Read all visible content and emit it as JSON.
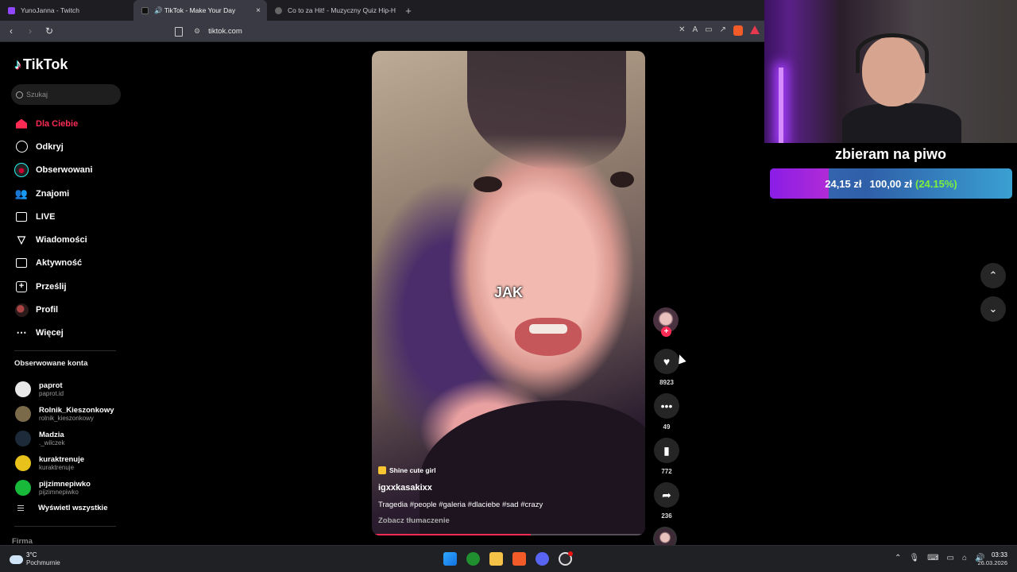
{
  "browser": {
    "tabs": [
      {
        "label": "YunoJanna - Twitch",
        "favicon_color": "#9146ff",
        "active": false
      },
      {
        "label": "🔊 TikTok - Make Your Day",
        "favicon_color": "#111111",
        "active": true
      },
      {
        "label": "Co to za Hit! - Muzyczny Quiz Hip-H",
        "favicon_color": "#666666",
        "active": false
      }
    ],
    "new_tab": "+",
    "close_glyph": "×",
    "url": "tiktok.com"
  },
  "tiktok": {
    "logo": "TikTok",
    "search_placeholder": "Szukaj",
    "menu": [
      {
        "label": "Dla Ciebie",
        "icon": "home-icon",
        "active": true
      },
      {
        "label": "Odkryj",
        "icon": "compass-icon",
        "active": false
      },
      {
        "label": "Obserwowani",
        "icon": "following-avatar-icon",
        "active": false
      },
      {
        "label": "Znajomi",
        "icon": "friends-icon",
        "active": false
      },
      {
        "label": "LIVE",
        "icon": "live-tv-icon",
        "active": false
      },
      {
        "label": "Wiadomości",
        "icon": "messages-icon",
        "active": false
      },
      {
        "label": "Aktywność",
        "icon": "activity-icon",
        "active": false
      },
      {
        "label": "Prześlij",
        "icon": "upload-icon",
        "active": false
      },
      {
        "label": "Profil",
        "icon": "profile-avatar-icon",
        "active": false
      },
      {
        "label": "Więcej",
        "icon": "more-icon",
        "active": false
      }
    ],
    "followed_title": "Obserwowane konta",
    "followed": [
      {
        "name": "paprot",
        "handle": "paprot.id",
        "color": "#e8e8e8"
      },
      {
        "name": "Rolnik_Kieszonkowy",
        "handle": "rolnik_kieszonkowy",
        "color": "#7a6a4a"
      },
      {
        "name": "Madzia",
        "handle": "._wilczek",
        "color": "#1c2a3a"
      },
      {
        "name": "kuraktrenuje",
        "handle": "kuraktrenuje",
        "color": "#e8c21a"
      },
      {
        "name": "pijzimnepiwko",
        "handle": "pijzimnepiwko",
        "color": "#18b83a"
      }
    ],
    "show_all": "Wyświetl wszystkie",
    "footer_section": "Firma",
    "video": {
      "caption_word": "JAK",
      "effect": "Shine cute girl",
      "author": "igxxkasakixx",
      "description": "Tragedia #people #galeria #dlaciebe #sad #crazy",
      "translate": "Zobacz tłumaczenie",
      "progress": 0.58
    },
    "actions": {
      "follow_plus": "+",
      "likes": "8923",
      "comments": "49",
      "saves": "772",
      "shares": "236"
    },
    "nav_up": "⌃",
    "nav_down": "⌄"
  },
  "stream": {
    "goal_title": "zbieram na piwo",
    "current": "24,15 zł",
    "target": "100,00 zł",
    "percent": "(24.15%)",
    "fraction": 0.2415
  },
  "taskbar": {
    "temp": "3°C",
    "weather": "Pochmurnie",
    "time": "03:33",
    "date": "26.03.2026"
  }
}
